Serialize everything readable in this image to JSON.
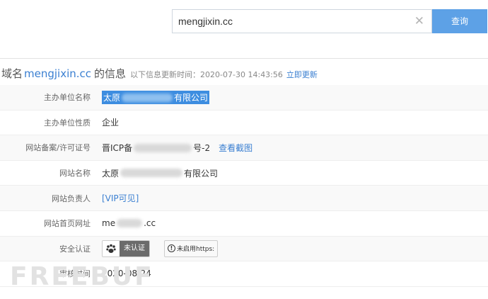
{
  "search": {
    "value": "mengjixin.cc",
    "clear_icon": "close-icon",
    "button_label": "查询"
  },
  "header": {
    "prefix": "域名",
    "domain": "mengjixin.cc",
    "suffix": "的信息",
    "note": "以下信息更新时间：2020-07-30 14:43:56",
    "refresh_link": "立即更新"
  },
  "rows": {
    "sponsor_name": {
      "label": "主办单位名称",
      "value_start": "太原",
      "value_end": "有限公司"
    },
    "sponsor_type": {
      "label": "主办单位性质",
      "value": "企业"
    },
    "icp": {
      "label": "网站备案/许可证号",
      "value_start": "晋ICP备",
      "value_end": "号-2",
      "link": "查看截图"
    },
    "site_name": {
      "label": "网站名称",
      "value_start": "太原",
      "value_end": "有限公司"
    },
    "site_owner": {
      "label": "网站负责人",
      "value": "[VIP可见]"
    },
    "homepage": {
      "label": "网站首页网址",
      "value_start": "me",
      "value_end": ".cc"
    },
    "security": {
      "label": "安全认证",
      "baidu_badge": "未认证",
      "https_badge": "未启用https:"
    },
    "review_time": {
      "label": "审核时间",
      "value": "2020-08-24"
    }
  },
  "watermark": "FREEBUF"
}
